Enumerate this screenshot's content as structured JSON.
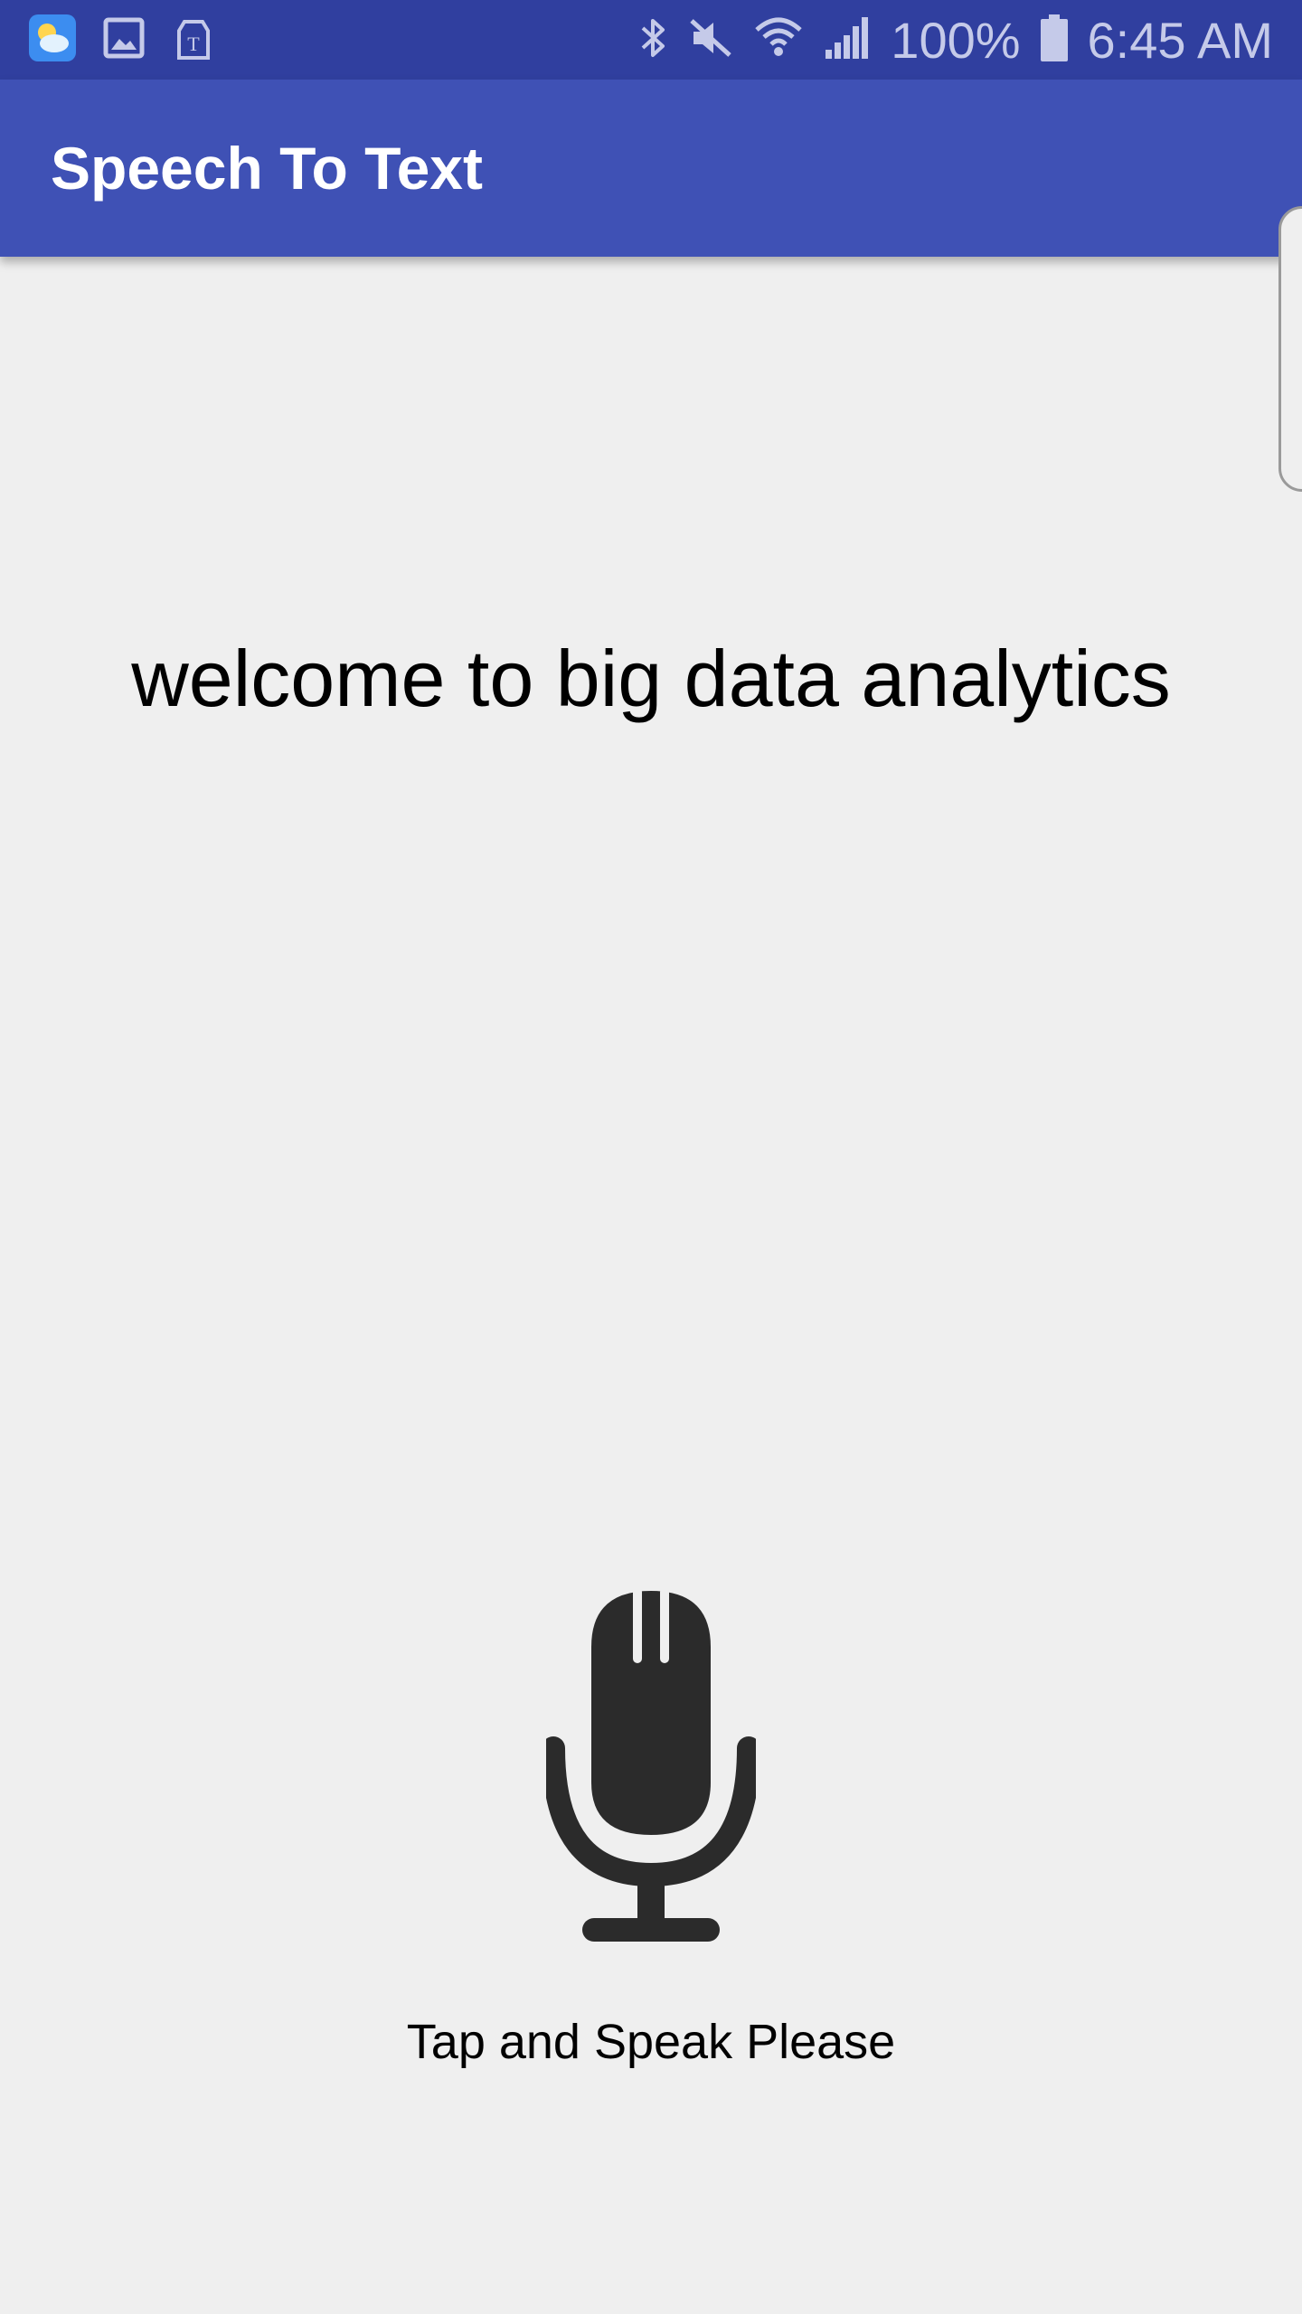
{
  "status_bar": {
    "left_icons": [
      "weather-icon",
      "gallery-icon",
      "t-mobile-icon"
    ],
    "right_icons": [
      "bluetooth-icon",
      "mute-icon",
      "wifi-icon",
      "signal-icon"
    ],
    "battery": "100%",
    "time": "6:45 AM",
    "bg_color": "#303f9f"
  },
  "app_bar": {
    "title": "Speech To Text",
    "bg_color": "#3f51b5"
  },
  "main": {
    "result_text": "welcome to big data analytics",
    "mic_icon": "microphone-icon",
    "prompt": "Tap and Speak Please"
  }
}
